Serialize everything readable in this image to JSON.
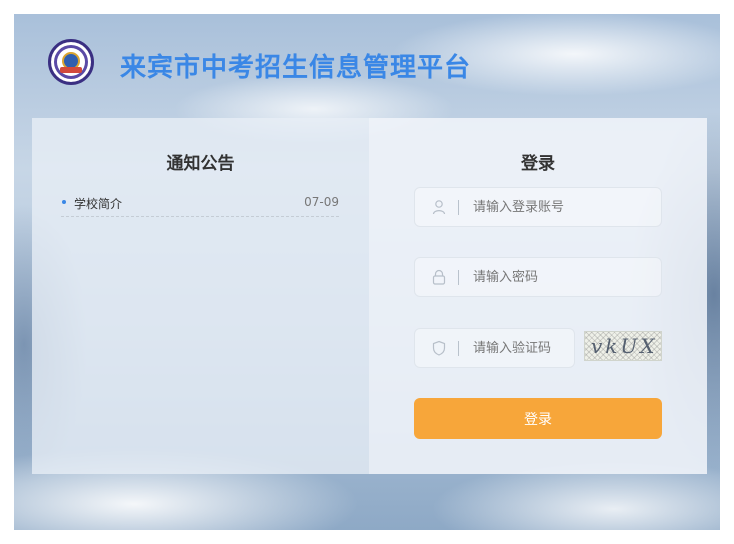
{
  "header": {
    "title": "来宾市中考招生信息管理平台",
    "logo_icon": "school-emblem-icon"
  },
  "notice": {
    "heading": "通知公告",
    "items": [
      {
        "title": "学校简介",
        "date": "07-09"
      }
    ]
  },
  "login": {
    "heading": "登录",
    "account": {
      "placeholder": "请输入登录账号",
      "icon": "user-icon"
    },
    "password": {
      "placeholder": "请输入密码",
      "icon": "lock-icon"
    },
    "captcha": {
      "placeholder": "请输入验证码",
      "icon": "shield-icon",
      "image_text": "vkUX"
    },
    "submit_label": "登录"
  },
  "colors": {
    "title": "#3a87e6",
    "button": "#f7a63a",
    "accent": "#3a87e6"
  }
}
